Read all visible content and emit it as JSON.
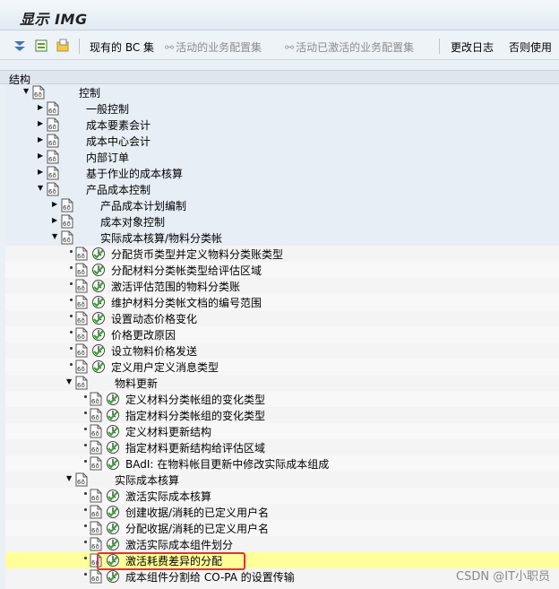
{
  "window": {
    "title": "显示 IMG"
  },
  "toolbar": {
    "current_bc_sets": "现有的 BC 集",
    "activate_bc_sets": "活动的业务配置集",
    "activated_bc_sets": "活动已激活的业务配置集",
    "change_log": "更改日志",
    "otherwise_use": "否则使用"
  },
  "structure_label": "结构",
  "tree": {
    "root": "控制",
    "n_general": "一般控制",
    "n_cost_elem": "成本要素会计",
    "n_cost_center": "成本中心会计",
    "n_internal_order": "内部订单",
    "n_abc": "基于作业的成本核算",
    "n_product_cost": "产品成本控制",
    "n_cost_planning": "产品成本计划编制",
    "n_cost_object": "成本对象控制",
    "n_actual_costing": "实际成本核算/物料分类帐",
    "a1": "分配货币类型并定义物料分类账类型",
    "a2": "分配材料分类帐类型给评估区域",
    "a3": "激活评估范围的物料分类账",
    "a4": "维护材料分类帐文档的编号范围",
    "a5": "设置动态价格变化",
    "a6": "价格更改原因",
    "a7": "设立物料价格发送",
    "a8": "定义用户定义消息类型",
    "n_material_update": "物料更新",
    "m1": "定义材料分类帐组的变化类型",
    "m2": "指定材料分类帐组的变化类型",
    "m3": "定义材料更新结构",
    "m4": "指定材料更新结构给评估区域",
    "m5": "BAdI: 在物料帐目更新中修改实际成本组成",
    "n_actual_cost_calc": "实际成本核算",
    "c1": "激活实际成本核算",
    "c2": "创建收据/消耗的已定义用户名",
    "c3": "分配收据/消耗的已定义用户名",
    "c4": "激活实际成本组件划分",
    "c5": "激活耗费差异的分配",
    "c6": "成本组件分割给 CO-PA 的设置传输"
  },
  "watermark": "CSDN @IT小职员"
}
